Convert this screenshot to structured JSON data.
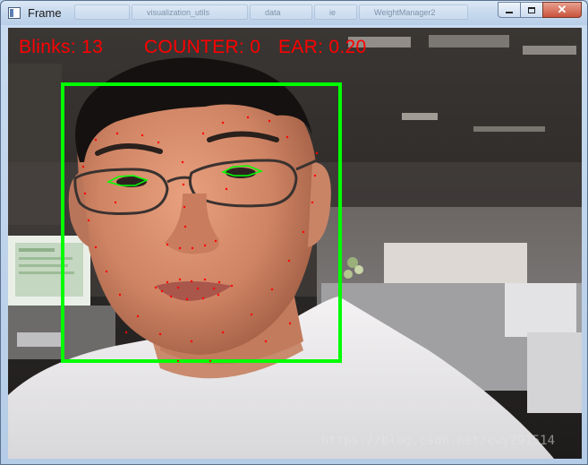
{
  "window": {
    "title": "Frame",
    "background_tabs": [
      "",
      "visualization_utils",
      "data",
      "ie",
      "WeightManager2"
    ]
  },
  "overlay": {
    "blinks_label": "Blinks: 13",
    "counter_label": "COUNTER: 0",
    "ear_label": "EAR: 0.20",
    "color": "#ff0000"
  },
  "detection": {
    "face_box_color": "#00ff00",
    "eye_contour_color": "#00ff00",
    "landmark_color": "#ff0000"
  },
  "watermark": "https://blog.csdn.net/cwy291514"
}
